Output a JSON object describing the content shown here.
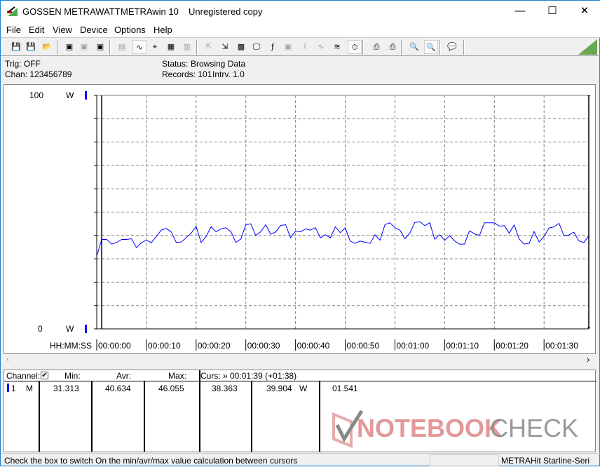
{
  "titlebar": {
    "brand": "GOSSEN METRAWATT",
    "app": "METRAwin 10",
    "registration": "Unregistered copy"
  },
  "menu": [
    "File",
    "Edit",
    "View",
    "Device",
    "Options",
    "Help"
  ],
  "toolbar": [
    {
      "name": "save-icon",
      "glyph": "💾"
    },
    {
      "name": "save-as-icon",
      "glyph": "💾"
    },
    {
      "name": "open-icon",
      "glyph": "📂"
    },
    {
      "name": "device-read-icon",
      "glyph": "▣"
    },
    {
      "name": "device-read-disabled-icon",
      "glyph": "▣"
    },
    {
      "name": "device-memory-icon",
      "glyph": "▣"
    },
    {
      "name": "display-digits-icon",
      "glyph": "▤"
    },
    {
      "name": "waveform-view-icon",
      "glyph": "∿"
    },
    {
      "name": "crosshair-icon",
      "glyph": "⌖"
    },
    {
      "name": "table-view-icon",
      "glyph": "▦"
    },
    {
      "name": "histogram-icon",
      "glyph": "▥"
    },
    {
      "name": "export-icon",
      "glyph": "⇱"
    },
    {
      "name": "import-icon",
      "glyph": "⇲"
    },
    {
      "name": "data-log-icon",
      "glyph": "▩"
    },
    {
      "name": "monitor-icon",
      "glyph": "🖵"
    },
    {
      "name": "function-icon",
      "glyph": "ƒ"
    },
    {
      "name": "device-settings-icon",
      "glyph": "▣"
    },
    {
      "name": "trigger-icon",
      "glyph": "⌇"
    },
    {
      "name": "sine-icon",
      "glyph": "∿"
    },
    {
      "name": "multi-wave-icon",
      "glyph": "≋"
    },
    {
      "name": "clock-icon",
      "glyph": "◷"
    },
    {
      "name": "timer-icon",
      "glyph": "⏱"
    },
    {
      "name": "print-preview-icon",
      "glyph": "⎙"
    },
    {
      "name": "print-icon",
      "glyph": "⎙"
    },
    {
      "name": "zoom-all-icon",
      "glyph": "🔍"
    },
    {
      "name": "zoom-wave-icon",
      "glyph": "🔍"
    },
    {
      "name": "comment-icon",
      "glyph": "💬"
    }
  ],
  "info": {
    "trig": "Trig: OFF",
    "chan": "Chan:  123456789",
    "status_label": "Status:",
    "status_value": "Browsing Data",
    "records": "Records: 101",
    "interval": "Intrv. 1.0"
  },
  "chart_data": {
    "type": "line",
    "xlabel": "HH:MM:SS",
    "x_ticks": [
      "00:00:00",
      "00:00:10",
      "00:00:20",
      "00:00:30",
      "00:00:40",
      "00:00:50",
      "00:01:00",
      "00:01:10",
      "00:01:20",
      "00:01:30"
    ],
    "xlim": [
      0,
      99
    ],
    "ylim": [
      0,
      100
    ],
    "y_ticks": [
      "100",
      "0"
    ],
    "y_unit": "W",
    "grid": true,
    "series_color": "#0000ff",
    "cursors_s": [
      1,
      99
    ],
    "values": [
      31.1,
      38.3,
      38.3,
      36.3,
      37.0,
      38.3,
      38.3,
      38.6,
      34.8,
      36.9,
      38.0,
      36.9,
      39.6,
      42.3,
      43.0,
      41.5,
      37.0,
      37.2,
      39.0,
      41.0,
      43.9,
      37.0,
      39.5,
      43.7,
      41.6,
      42.8,
      43.3,
      41.6,
      37.0,
      38.5,
      44.6,
      45.0,
      40.0,
      41.6,
      44.6,
      40.5,
      41.5,
      44.3,
      44.6,
      39.0,
      41.9,
      41.6,
      42.8,
      42.3,
      43.3,
      39.0,
      40.3,
      39.0,
      43.7,
      41.2,
      43.3,
      37.6,
      36.6,
      37.6,
      37.1,
      36.6,
      40.3,
      38.0,
      44.7,
      45.4,
      43.3,
      42.3,
      38.6,
      41.0,
      45.6,
      45.9,
      44.2,
      45.4,
      38.4,
      40.3,
      37.9,
      39.9,
      37.7,
      36.3,
      36.3,
      42.0,
      40.7,
      40.0,
      45.4,
      45.4,
      45.4,
      44.0,
      44.2,
      41.0,
      44.5,
      38.5,
      36.3,
      36.6,
      41.7,
      37.2,
      39.6,
      43.2,
      43.7,
      45.2,
      40.0,
      40.2,
      41.4,
      37.7,
      36.9,
      39.9
    ]
  },
  "table": {
    "headers": {
      "channel": "Channel:",
      "min": "Min:",
      "avr": "Avr:",
      "max": "Max:",
      "curs": "Curs: » 00:01:39 (+01:38)"
    },
    "row": {
      "num": "1",
      "mode": "M",
      "min": "31.313",
      "avr": "40.634",
      "max": "46.055",
      "c1": "38.363",
      "c2": "39.904",
      "unit": "W",
      "diff": "01.541"
    }
  },
  "watermark": "NOTEBOOKCHECK",
  "status": {
    "hint": "Check the box to switch On the min/avr/max value calculation between cursors",
    "device": "METRAHit Starline-Seri"
  }
}
